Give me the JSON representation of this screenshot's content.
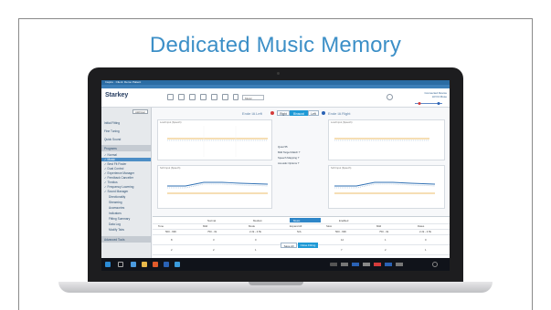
{
  "slide": {
    "title": "Dedicated Music Memory"
  },
  "app": {
    "window_title": "Inspire · Client: Demo Patient",
    "brand": "Starkey",
    "program_dropdown": "Music",
    "patient_info_line1": "Connected Device",
    "patient_info_line2": "LR Fit Muse",
    "sidebar": {
      "button": "Add User",
      "items": [
        {
          "label": "Initial Fitting"
        },
        {
          "label": "Fine Tuning"
        },
        {
          "label": "Quick Sound"
        },
        {
          "label": "Programs"
        },
        {
          "label": "✓ Normal"
        },
        {
          "label": "✓ Music"
        },
        {
          "label": "✓ Best Fit Finder"
        },
        {
          "label": "✓ Dual Control"
        },
        {
          "label": "✓ Experience Manager"
        },
        {
          "label": "✓ Feedback Canceller"
        },
        {
          "label": "✓ Tinnitus"
        },
        {
          "label": "✓ Frequency Lowering"
        },
        {
          "label": "✓ Sound Manager"
        },
        {
          "label": "Directionality"
        },
        {
          "label": "Streaming"
        },
        {
          "label": "Accessories"
        },
        {
          "label": "Indicators"
        },
        {
          "label": "Fitting Summary"
        },
        {
          "label": "Data Log"
        },
        {
          "label": "Modify Tabs"
        },
        {
          "label": "Advanced Tools"
        }
      ]
    },
    "tabs": {
      "left_ear_label": "Ende IA Left",
      "right_ear_label": "Ende IA Right",
      "right": "Right",
      "binaural": "Binaural",
      "left": "Left"
    },
    "graphs": {
      "top_left_title": "Loud Input (Speech)",
      "top_right_title": "Loud Input (Speech)",
      "bottom_left_title": "Soft Input (Speech)",
      "bottom_right_title": "Soft Input (Speech)"
    },
    "options": [
      {
        "label": "Quiet 55"
      },
      {
        "label": "Mild Target Match ?"
      },
      {
        "label": "Speech Mapping ?"
      },
      {
        "label": "Acoustic Options ?"
      }
    ],
    "table": {
      "filters": [
        "Normal",
        "Medium",
        "Music",
        "Enabled"
      ],
      "left_headers": [
        "Tone",
        "Mild",
        "Mode"
      ],
      "right_headers": [
        "Expand All",
        "Slow",
        "Mild",
        "Dates"
      ],
      "left_ranges": [
        "500 - 996",
        "750 - 3k",
        "2.2k - 4.5k"
      ],
      "mid_range": "N/A",
      "right_ranges": [
        "500 - 996",
        "750 - 3k",
        "2.2k - 4.5k"
      ],
      "row1": [
        "8",
        "3",
        "0",
        "12",
        "1",
        "0"
      ],
      "row2": [
        "2",
        "2",
        "1",
        "7",
        "2",
        "1"
      ]
    },
    "buttons": {
      "save": "Save All",
      "finish": "Close Fitting"
    }
  }
}
